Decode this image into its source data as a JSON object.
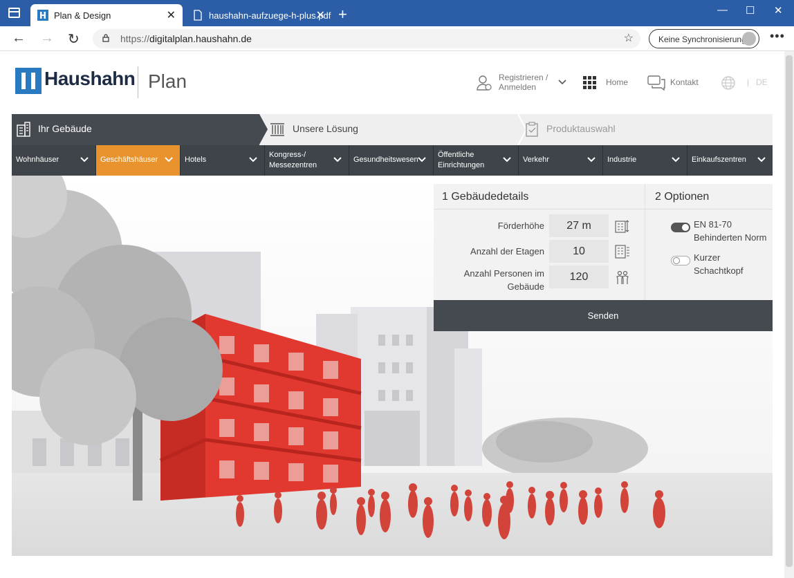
{
  "browser": {
    "tabs": [
      {
        "title": "Plan & Design",
        "active": true,
        "favicon": "haushahn-favicon-icon"
      },
      {
        "title": "haushahn-aufzuege-h-plus.pdf",
        "active": false,
        "favicon": "document-icon"
      }
    ],
    "url_prefix": "https://",
    "url_domain": "digitalplan.haushahn.de",
    "sync_label": "Keine Synchronisierung"
  },
  "header": {
    "brand": "Haushahn",
    "sub": "Plan",
    "register_line1": "Registrieren /",
    "register_line2": "Anmelden",
    "home_label": "Home",
    "contact_label": "Kontakt",
    "lang": "DE"
  },
  "steps": [
    {
      "label": "Ihr Gebäude",
      "state": "active"
    },
    {
      "label": "Unsere Lösung",
      "state": "next"
    },
    {
      "label": "Produktauswahl",
      "state": "disabled"
    }
  ],
  "categories": [
    {
      "line1": "Wohnhäuser",
      "line2": ""
    },
    {
      "line1": "Geschäftshäuser",
      "line2": "",
      "active": true
    },
    {
      "line1": "Hotels",
      "line2": ""
    },
    {
      "line1": "Kongress-/",
      "line2": "Messezentren"
    },
    {
      "line1": "Gesundheitswesen",
      "line2": ""
    },
    {
      "line1": "Öffentliche",
      "line2": "Einrichtungen"
    },
    {
      "line1": "Verkehr",
      "line2": ""
    },
    {
      "line1": "Industrie",
      "line2": ""
    },
    {
      "line1": "Einkaufszentren",
      "line2": ""
    }
  ],
  "form": {
    "details_title": "1 Gebäudedetails",
    "options_title": "2 Optionen",
    "fields": [
      {
        "label": "Förderhöhe",
        "value": "27 m"
      },
      {
        "label": "Anzahl der Etagen",
        "value": "10"
      },
      {
        "label_line1": "Anzahl Personen im",
        "label_line2": "Gebäude",
        "value": "120"
      }
    ],
    "options": [
      {
        "line1": "EN 81-70",
        "line2": "Behinderten Norm",
        "enabled": true
      },
      {
        "line1": "Kurzer",
        "line2": "Schachtkopf",
        "enabled": false
      }
    ],
    "submit": "Senden"
  },
  "colors": {
    "chrome_blue": "#2c5ea8",
    "brand_blue": "#2a7ac1",
    "dark": "#454a51",
    "accent_orange": "#e8932e",
    "building_red": "#e1392f"
  }
}
